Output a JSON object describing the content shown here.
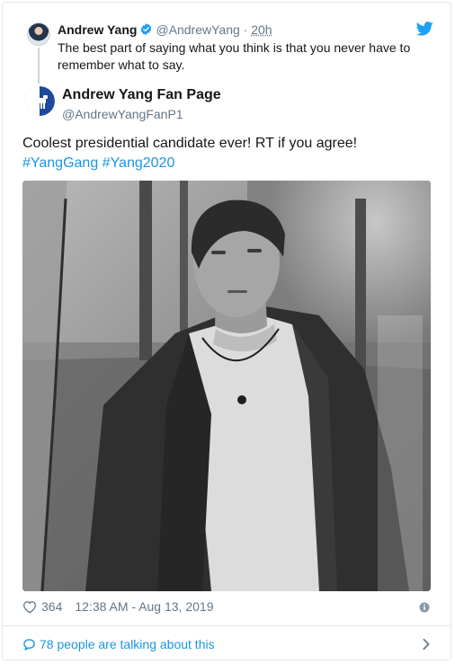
{
  "reply": {
    "name": "Andrew Yang",
    "handle": "@AndrewYang",
    "separator": " · ",
    "time": "20h",
    "text": "The best part of saying what you think is that you never have to remember what to say."
  },
  "tweet": {
    "name": "Andrew Yang Fan Page",
    "handle": "@AndrewYangFanP1",
    "text": "Coolest presidential candidate ever! RT if you agree!",
    "hashtags": [
      "#YangGang",
      "#Yang2020"
    ]
  },
  "footer": {
    "likes": "364",
    "timestamp": "12:38 AM - Aug 13, 2019",
    "talking": "78 people are talking about this"
  },
  "icons": {
    "verified": "verified-badge-icon",
    "brand": "twitter-bird-icon",
    "like": "heart-icon",
    "info": "info-icon",
    "conversation": "speech-bubble-icon",
    "more": "chevron-right-icon"
  },
  "colors": {
    "link": "#1b95e0",
    "secondary_text": "#657786",
    "primary_text": "#14171a",
    "border": "#e1e8ed",
    "fan_page_logo": "#1d4a9c"
  }
}
